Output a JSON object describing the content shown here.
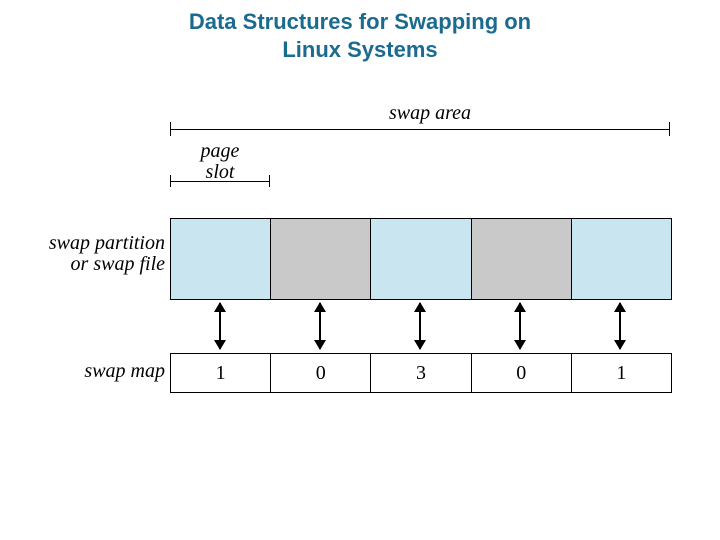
{
  "title_line1": "Data Structures for Swapping on",
  "title_line2": "Linux Systems",
  "labels": {
    "swap_area": "swap area",
    "page_slot_l1": "page",
    "page_slot_l2": "slot",
    "swap_partition_l1": "swap partition",
    "swap_partition_l2": "or swap file",
    "swap_map": "swap map"
  },
  "slot_colors": [
    "blue",
    "grey",
    "blue",
    "grey",
    "blue"
  ],
  "swap_map_values": [
    "1",
    "0",
    "3",
    "0",
    "1"
  ],
  "chart_data": {
    "type": "table",
    "title": "Data Structures for Swapping on Linux Systems",
    "rows": [
      {
        "name": "swap partition or swap file",
        "slots": [
          "used",
          "free",
          "used",
          "free",
          "used"
        ]
      },
      {
        "name": "swap map",
        "slots": [
          1,
          0,
          3,
          0,
          1
        ]
      }
    ],
    "annotations": [
      "swap area spans all 5 slots",
      "page slot spans 1 slot"
    ]
  }
}
